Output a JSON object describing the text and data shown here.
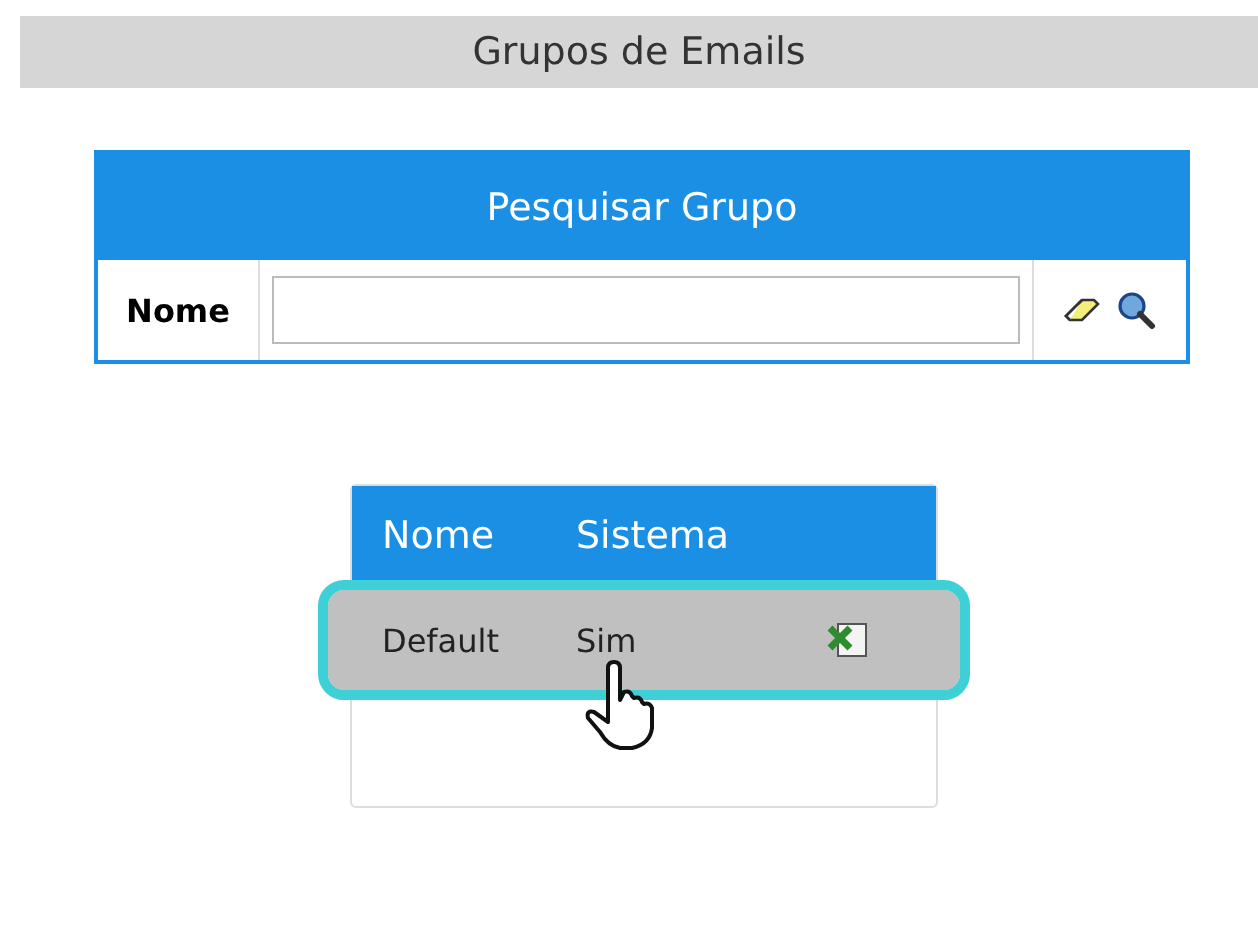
{
  "page_title": "Grupos de Emails",
  "search": {
    "title": "Pesquisar Grupo",
    "label": "Nome"
  },
  "results": {
    "columns": [
      "Nome",
      "Sistema"
    ],
    "rows": [
      {
        "cells": [
          "Default",
          "Sim"
        ],
        "selected": true
      }
    ]
  }
}
